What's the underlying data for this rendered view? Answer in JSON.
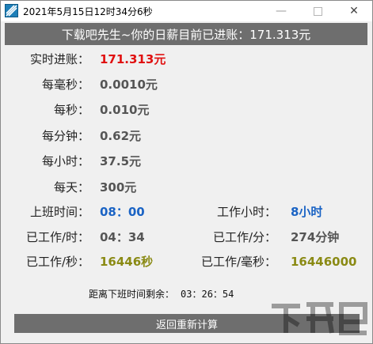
{
  "window": {
    "title": "2021年5月15日12时34分6秒",
    "icon": "app-stripes-icon",
    "min_glyph": "—",
    "close_glyph": "✕"
  },
  "banner": "下载吧先生~你的日薪目前已进账：171.313元",
  "rows": {
    "realtime": {
      "label": "实时进账：",
      "value": "171.313元"
    },
    "per_ms": {
      "label": "每毫秒：",
      "value": "0.0010元"
    },
    "per_sec": {
      "label": "每秒：",
      "value": "0.010元"
    },
    "per_min": {
      "label": "每分钟：",
      "value": "0.62元"
    },
    "per_hour": {
      "label": "每小时：",
      "value": "37.5元"
    },
    "per_day": {
      "label": "每天：",
      "value": "300元"
    }
  },
  "work": {
    "start_label": "上班时间：",
    "start_value": "08：00",
    "hours_label": "工作小时：",
    "hours_value": "8小时",
    "worked_h_label": "已工作/时：",
    "worked_h_value": "04：34",
    "worked_m_label": "已工作/分：",
    "worked_m_value": "274分钟",
    "worked_s_label": "已工作/秒：",
    "worked_s_value": "16446秒",
    "worked_ms_label": "已工作/毫秒：",
    "worked_ms_value": "16446000"
  },
  "remaining": {
    "label": "距离下班时间剩余：",
    "value": "03：26：54"
  },
  "recalc_button": "返回重新计算",
  "colors": {
    "banner_bg": "#6e6e6e",
    "highlight_red": "#e01010",
    "highlight_blue": "#1a63c4",
    "highlight_olive": "#8a8a14"
  }
}
